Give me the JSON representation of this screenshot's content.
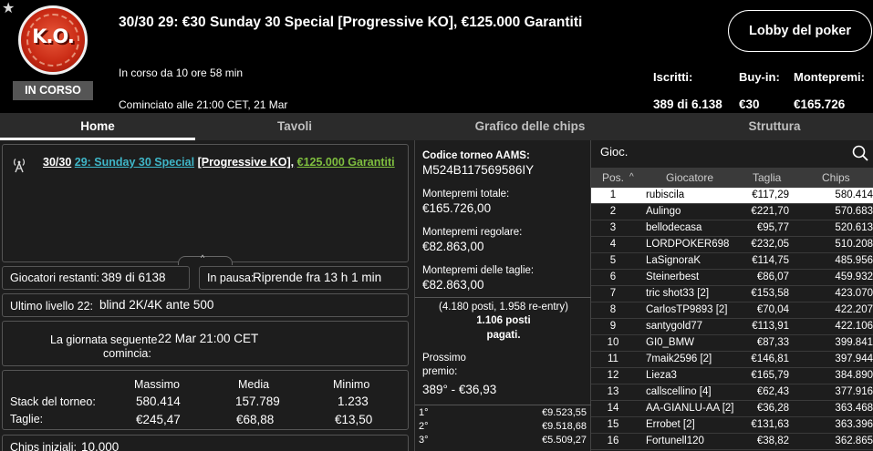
{
  "header": {
    "star_glyph": "★",
    "logo_text": "K.O.",
    "status": "IN CORSO",
    "title": "30/30 29: €30 Sunday 30 Special [Progressive KO], €125.000 Garantiti",
    "running": "In corso da 10 ore 58 min",
    "started": "Cominciato alle 21:00 CET, 21 Mar",
    "lobby_button": "Lobby del poker",
    "stats": [
      {
        "label": "Iscritti:",
        "value": "389 di 6.138"
      },
      {
        "label": "Buy-in:",
        "value": "€30"
      },
      {
        "label": "Montepremi:",
        "value": "€165.726"
      }
    ]
  },
  "tabs": [
    {
      "label": "Home",
      "active": true
    },
    {
      "label": "Tavoli",
      "active": false
    },
    {
      "label": "Grafico delle chips",
      "active": false
    },
    {
      "label": "Struttura",
      "active": false
    }
  ],
  "home": {
    "name_parts": {
      "p1": "30/30",
      "p2": "29: Sunday 30 Special",
      "p3": "[Progressive KO],",
      "p4": "€125.000 Garantiti"
    },
    "expand_glyph": "^",
    "players_left_label": "Giocatori restanti:",
    "players_left_value": "389 di 6138",
    "paused_label": "In pausa:",
    "paused_value": "Riprende fra 13 h 1 min",
    "last_level_label": "Ultimo livello 22:",
    "last_level_value": "blind 2K/4K ante 500",
    "next_day_label_1": "La giornata seguente",
    "next_day_label_2": "comincia:",
    "next_day_value": "22 Mar 21:00 CET",
    "stats_table": {
      "headers": [
        "Massimo",
        "Media",
        "Minimo"
      ],
      "rows": [
        {
          "label": "Stack del torneo:",
          "values": [
            "580.414",
            "157.789",
            "1.233"
          ]
        },
        {
          "label": "Taglie:",
          "values": [
            "€245,47",
            "€68,88",
            "€13,50"
          ]
        }
      ]
    },
    "initial_chips_label": "Chips iniziali:",
    "initial_chips_value": "10.000"
  },
  "middle": {
    "aams_label": "Codice torneo AAMS:",
    "aams_value": "M524B117569586IY",
    "total_label": "Montepremi totale:",
    "total_value": "€165.726,00",
    "regular_label": "Montepremi regolare:",
    "regular_value": "€82.863,00",
    "bounty_label": "Montepremi delle taglie:",
    "bounty_value": "€82.863,00",
    "paid_line1": "(4.180 posti, 1.958 re-entry)",
    "paid_line2": "1.106 posti",
    "paid_line3": "pagati.",
    "next_prize_label_1": "Prossimo",
    "next_prize_label_2": "premio:",
    "next_prize_value": "389° - €36,93",
    "prizes": [
      {
        "pos": "1°",
        "amount": "€9.523,55"
      },
      {
        "pos": "2°",
        "amount": "€9.518,68"
      },
      {
        "pos": "3°",
        "amount": "€5.509,27"
      }
    ]
  },
  "players": {
    "search_label": "Gioc.",
    "columns": [
      "Pos.",
      "Giocatore",
      "Taglia",
      "Chips"
    ],
    "sort_glyph": "^",
    "rows": [
      {
        "pos": "1",
        "name": "rubiscila",
        "bounty": "€117,29",
        "chips": "580.414"
      },
      {
        "pos": "2",
        "name": "Aulingo",
        "bounty": "€221,70",
        "chips": "570.683"
      },
      {
        "pos": "3",
        "name": "bellodecasa",
        "bounty": "€95,77",
        "chips": "520.613"
      },
      {
        "pos": "4",
        "name": "LORDPOKER698",
        "bounty": "€232,05",
        "chips": "510.208"
      },
      {
        "pos": "5",
        "name": "LaSignoraK",
        "bounty": "€114,75",
        "chips": "485.956"
      },
      {
        "pos": "6",
        "name": "Steinerbest",
        "bounty": "€86,07",
        "chips": "459.932"
      },
      {
        "pos": "7",
        "name": "tric shot33 [2]",
        "bounty": "€153,58",
        "chips": "423.070"
      },
      {
        "pos": "8",
        "name": "CarlosTP9893 [2]",
        "bounty": "€70,04",
        "chips": "422.207"
      },
      {
        "pos": "9",
        "name": "santygold77",
        "bounty": "€113,91",
        "chips": "422.106"
      },
      {
        "pos": "10",
        "name": "GI0_BMW",
        "bounty": "€87,33",
        "chips": "399.841"
      },
      {
        "pos": "11",
        "name": "7maik2596 [2]",
        "bounty": "€146,81",
        "chips": "397.944"
      },
      {
        "pos": "12",
        "name": "Lieza3",
        "bounty": "€165,79",
        "chips": "384.890"
      },
      {
        "pos": "13",
        "name": "callscellino [4]",
        "bounty": "€62,43",
        "chips": "377.916"
      },
      {
        "pos": "14",
        "name": "AA-GIANLU-AA [2]",
        "bounty": "€36,28",
        "chips": "363.468"
      },
      {
        "pos": "15",
        "name": "Errobet [2]",
        "bounty": "€131,63",
        "chips": "363.396"
      },
      {
        "pos": "16",
        "name": "Fortunell120",
        "bounty": "€38,82",
        "chips": "362.865"
      }
    ]
  }
}
